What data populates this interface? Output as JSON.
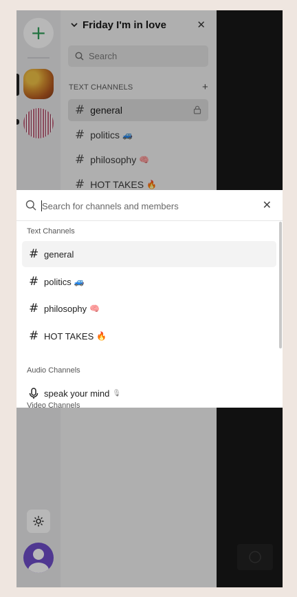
{
  "server": {
    "name": "Friday I'm in love"
  },
  "sidebar": {
    "search_placeholder": "Search",
    "section_title": "TEXT CHANNELS",
    "channels": [
      {
        "name": "general",
        "emoji": ""
      },
      {
        "name": "politics",
        "emoji": "🚙"
      },
      {
        "name": "philosophy",
        "emoji": "🧠"
      },
      {
        "name": "HOT TAKES",
        "emoji": "🔥"
      }
    ]
  },
  "quick_switcher": {
    "placeholder": "Search for channels and members",
    "groups": {
      "text": "Text Channels",
      "audio": "Audio Channels",
      "video": "Video Channels"
    },
    "text_channels": [
      {
        "name": "general",
        "emoji": ""
      },
      {
        "name": "politics",
        "emoji": "🚙"
      },
      {
        "name": "philosophy",
        "emoji": "🧠"
      },
      {
        "name": "HOT TAKES",
        "emoji": "🔥"
      }
    ],
    "audio_channels": [
      {
        "name": "speak your mind",
        "emoji": "🎙"
      }
    ]
  },
  "colors": {
    "accent_green": "#2a9d55",
    "avatar_purple": "#6a48c8",
    "chat_background": "#111111"
  }
}
